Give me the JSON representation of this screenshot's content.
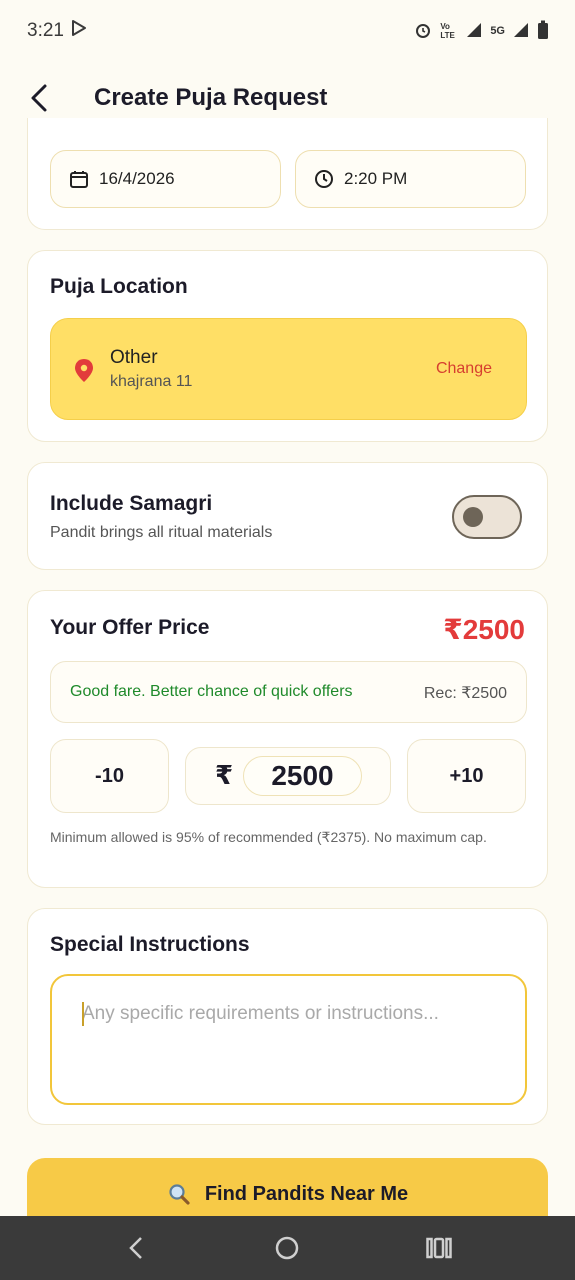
{
  "status_bar": {
    "time": "3:21",
    "network": "5G",
    "volte": "Vo LTE"
  },
  "header": {
    "title": "Create Puja Request"
  },
  "datetime": {
    "date": "16/4/2026",
    "time": "2:20 PM"
  },
  "location": {
    "section_title": "Puja Location",
    "name": "Other",
    "address": "khajrana 11",
    "change_label": "Change"
  },
  "samagri": {
    "title": "Include Samagri",
    "subtitle": "Pandit brings all ritual materials",
    "enabled": false
  },
  "offer": {
    "title": "Your Offer Price",
    "price_display": "₹2500",
    "fare_message": "Good fare. Better chance of quick offers",
    "recommended": "Rec: ₹2500",
    "decrement_label": "-10",
    "increment_label": "+10",
    "currency_symbol": "₹",
    "amount": "2500",
    "note": "Minimum allowed is 95% of recommended (₹2375). No maximum cap."
  },
  "instructions": {
    "title": "Special Instructions",
    "placeholder": "Any specific requirements or instructions..."
  },
  "cta": {
    "label": "Find Pandits Near Me"
  },
  "colors": {
    "accent": "#f7ca47",
    "location_bg": "#ffdf66",
    "price_red": "#e33b3b",
    "good_green": "#1f8a2b"
  }
}
